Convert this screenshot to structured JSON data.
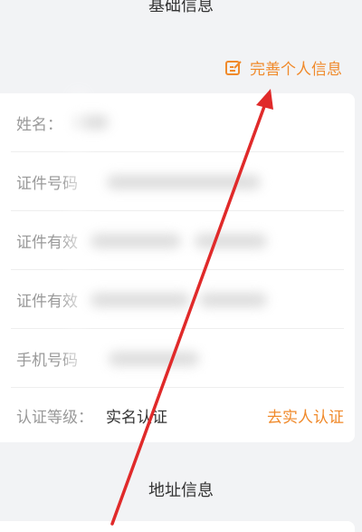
{
  "sections": {
    "basic_title": "基础信息",
    "address_title": "地址信息"
  },
  "complete_link": {
    "label": "完善个人信息",
    "icon": "edit-icon"
  },
  "rows": [
    {
      "label": "姓名："
    },
    {
      "label": "证件号码"
    },
    {
      "label": "证件有效"
    },
    {
      "label": "证件有效"
    },
    {
      "label": "手机号码"
    }
  ],
  "cert_row": {
    "label": "认证等级：",
    "value": "实名认证",
    "action": "去实人认证"
  },
  "colors": {
    "accent": "#f08a2b",
    "arrow": "#e02a2a",
    "background": "#f2f3f5"
  }
}
